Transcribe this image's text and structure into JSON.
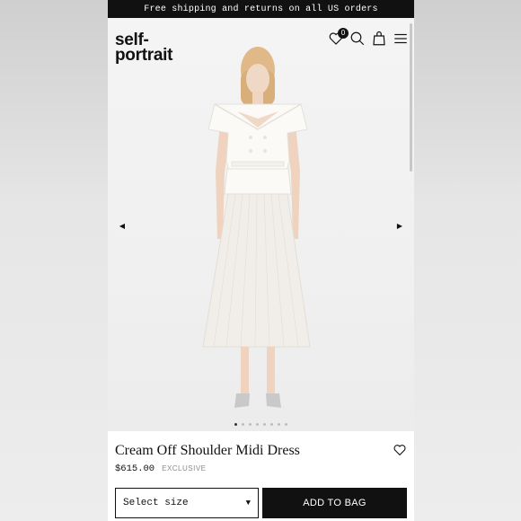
{
  "promo": {
    "text": "Free shipping and returns on all US orders"
  },
  "header": {
    "logo_line1": "self-",
    "logo_line2": "portrait",
    "wishlist_count": "0",
    "icons": [
      "heart-icon",
      "search-icon",
      "bag-icon",
      "menu-icon"
    ]
  },
  "gallery": {
    "slide_count": 8,
    "active_slide": 1,
    "prev_label": "◀",
    "next_label": "▶"
  },
  "product": {
    "title": "Cream Off Shoulder Midi Dress",
    "price": "$615.00",
    "tag": "EXCLUSIVE"
  },
  "actions": {
    "size_placeholder": "Select size",
    "caret": "▼",
    "add_to_bag": "ADD TO BAG"
  },
  "colors": {
    "accent": "#111111",
    "background": "#ffffff",
    "gallery_bg": "#f2f2f2"
  }
}
